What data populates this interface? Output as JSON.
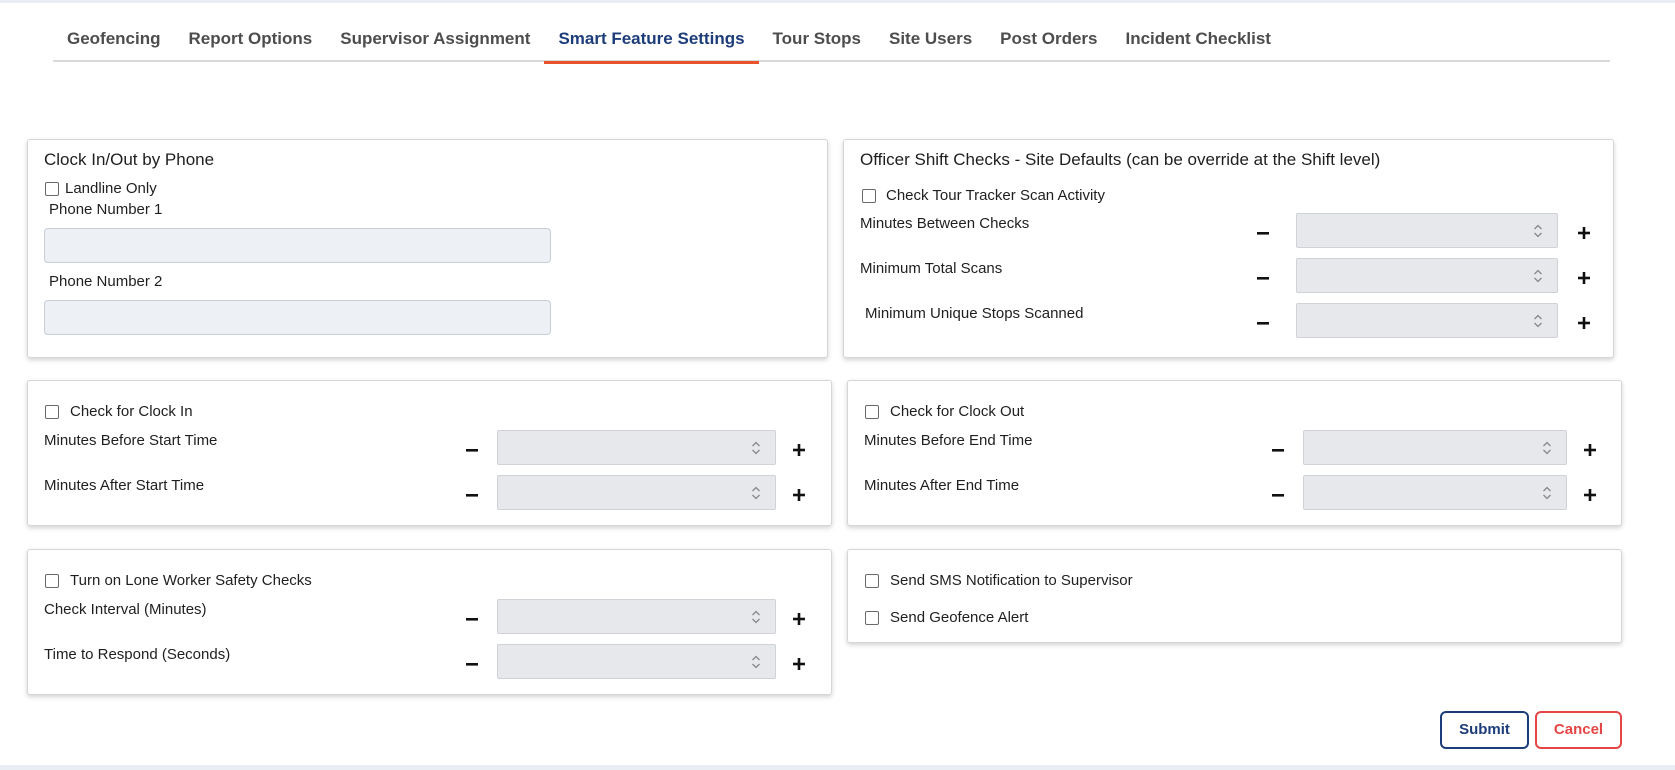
{
  "tabs": [
    {
      "label": "Geofencing"
    },
    {
      "label": "Report Options"
    },
    {
      "label": "Supervisor Assignment"
    },
    {
      "label": "Smart Feature Settings",
      "active": true
    },
    {
      "label": "Tour Stops"
    },
    {
      "label": "Site Users"
    },
    {
      "label": "Post Orders"
    },
    {
      "label": "Incident Checklist"
    }
  ],
  "clock_phone": {
    "title": "Clock In/Out by Phone",
    "landline_label": "Landline Only",
    "phone1_label": "Phone Number 1",
    "phone1_value": "",
    "phone2_label": "Phone Number 2",
    "phone2_value": ""
  },
  "shift_checks": {
    "title": "Officer Shift Checks - Site Defaults (can be override at the Shift level)",
    "tour_tracker_label": "Check Tour Tracker Scan Activity",
    "minutes_between_label": "Minutes Between Checks",
    "min_total_scans_label": "Minimum Total Scans",
    "min_unique_stops_label": "Minimum Unique Stops Scanned"
  },
  "clock_in": {
    "check_label": "Check for Clock In",
    "before_label": "Minutes Before Start Time",
    "after_label": "Minutes After Start Time"
  },
  "clock_out": {
    "check_label": "Check for Clock Out",
    "before_label": "Minutes Before End Time",
    "after_label": "Minutes After End Time"
  },
  "lone_worker": {
    "check_label": "Turn on Lone Worker Safety Checks",
    "interval_label": "Check Interval (Minutes)",
    "respond_label": "Time to Respond (Seconds)"
  },
  "notifications": {
    "sms_label": "Send SMS Notification to Supervisor",
    "geofence_label": "Send Geofence Alert"
  },
  "actions": {
    "submit_label": "Submit",
    "cancel_label": "Cancel"
  },
  "colors": {
    "accent_tab": "#e8532b",
    "primary": "#1d3d7a",
    "danger": "#e64545"
  }
}
